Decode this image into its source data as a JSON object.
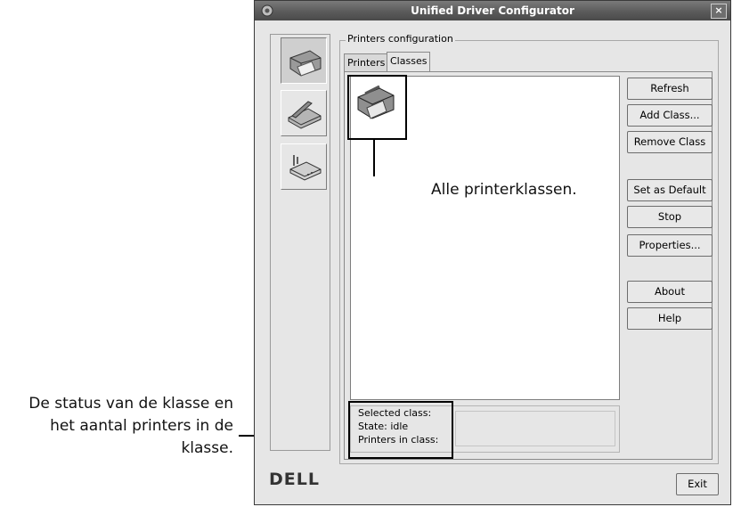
{
  "window": {
    "title": "Unified Driver Configurator",
    "close_glyph": "×",
    "app_icon": "gear-icon"
  },
  "sidebar": {
    "items": [
      {
        "name": "printers",
        "icon": "printer-icon",
        "active": true
      },
      {
        "name": "scanners",
        "icon": "scanner-icon",
        "active": false
      },
      {
        "name": "ports",
        "icon": "port-device-icon",
        "active": false
      }
    ]
  },
  "group": {
    "label": "Printers configuration"
  },
  "tabs": [
    {
      "label": "Printers",
      "active": false
    },
    {
      "label": "Classes",
      "active": true
    }
  ],
  "class_list": {
    "items": [
      {
        "icon": "printer-class-icon"
      }
    ]
  },
  "buttons": {
    "refresh": "Refresh",
    "add_class": "Add Class...",
    "remove_class": "Remove Class",
    "set_default": "Set as Default",
    "stop": "Stop",
    "properties": "Properties...",
    "about": "About",
    "help": "Help"
  },
  "status": {
    "selected_class": "Selected class:",
    "state": "State: idle",
    "printers_in_class": "Printers in class:"
  },
  "footer": {
    "logo": "DELL",
    "exit": "Exit"
  },
  "annotations": {
    "inside": "Alle printerklassen.",
    "left_lines": [
      "De status van de klasse en",
      "het aantal printers in de",
      "klasse."
    ]
  }
}
